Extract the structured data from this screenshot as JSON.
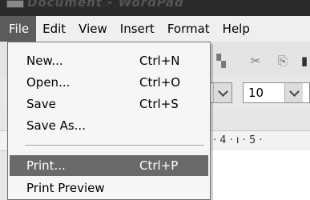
{
  "titlebar": {
    "title_ghost": "Document - WordPad"
  },
  "menubar": {
    "items": [
      "File",
      "Edit",
      "View",
      "Insert",
      "Format",
      "Help"
    ]
  },
  "file_menu": {
    "items": [
      {
        "label": "New...",
        "shortcut": "Ctrl+N"
      },
      {
        "label": "Open...",
        "shortcut": "Ctrl+O"
      },
      {
        "label": "Save",
        "shortcut": "Ctrl+S"
      },
      {
        "label": "Save As...",
        "shortcut": ""
      },
      {
        "label": "Print...",
        "shortcut": "Ctrl+P"
      },
      {
        "label": "Print Preview",
        "shortcut": ""
      }
    ],
    "highlighted": "Print..."
  },
  "toolbar": {
    "font_size_value": "10",
    "icons": [
      "print-preview-icon",
      "cut-icon",
      "copy-icon",
      "paste-icon"
    ]
  },
  "ruler": {
    "text": "· 4 · ı · 5 ·"
  },
  "colors": {
    "menu_active_bg": "#5c5c5c",
    "item_highlight_bg": "#6a6a6a"
  }
}
